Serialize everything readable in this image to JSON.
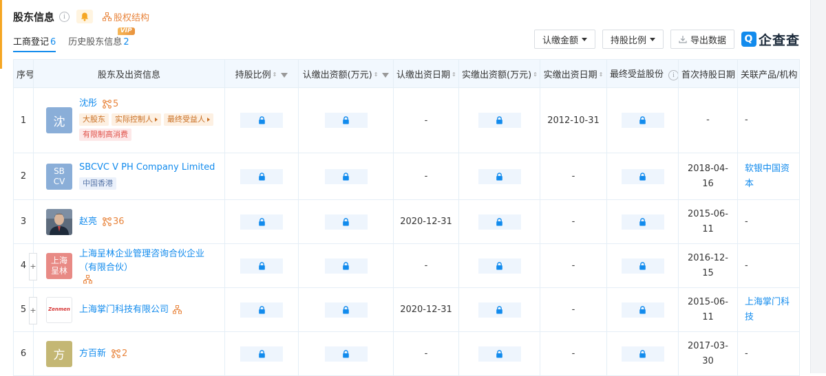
{
  "header": {
    "title": "股东信息",
    "info_icon": "i",
    "equity_link": "股权结构"
  },
  "tabs": [
    {
      "label": "工商登记",
      "count": "6",
      "active": true
    },
    {
      "label": "历史股东信息",
      "count": "2",
      "badge": "VIP"
    }
  ],
  "toolbar": {
    "subscribed_amount": "认缴金额",
    "share_ratio": "持股比例",
    "export": "导出数据",
    "logo_mark": "Q",
    "logo_text": "企查查"
  },
  "table": {
    "headers": [
      "序号",
      "股东及出资信息",
      "持股比例",
      "认缴出资额(万元)",
      "认缴出资日期",
      "实缴出资额(万元)",
      "实缴出资日期",
      "最终受益股份",
      "首次持股日期",
      "关联产品/机构"
    ],
    "rows": [
      {
        "index": "1",
        "avatar_text": "沈",
        "avatar_color": "#8aaed8",
        "name": "沈彤",
        "relation_count": "5",
        "tags": [
          {
            "text": "大股东",
            "style": "orange",
            "arrow": false
          },
          {
            "text": "实际控制人",
            "style": "orange",
            "arrow": true
          },
          {
            "text": "最终受益人",
            "style": "orange",
            "arrow": true
          },
          {
            "text": "有限制高消费",
            "style": "red",
            "arrow": false
          }
        ],
        "sub_date": "-",
        "paid_date": "2012-10-31",
        "first_date": "-",
        "related": "-"
      },
      {
        "index": "2",
        "avatar_text": "SB CV",
        "avatar_color": "#8aaed8",
        "name": "SBCVC V PH Company Limited",
        "tags": [
          {
            "text": "中国香港",
            "style": "blue",
            "arrow": false
          }
        ],
        "sub_date": "-",
        "paid_date": "-",
        "first_date": "2018-04-16",
        "related": "软银中国资本"
      },
      {
        "index": "3",
        "avatar_text": "",
        "avatar_color": "#4a5563",
        "photo": true,
        "name": "赵亮",
        "relation_count": "36",
        "tags": [],
        "sub_date": "2020-12-31",
        "paid_date": "-",
        "first_date": "2015-06-11",
        "related": "-"
      },
      {
        "index": "4",
        "avatar_text": "上海 呈林",
        "avatar_color": "#e88a85",
        "expand": "+",
        "name": "上海呈林企业管理咨询合伙企业（有限合伙）",
        "structure_icon": true,
        "tags": [],
        "sub_date": "-",
        "paid_date": "-",
        "first_date": "2016-12-15",
        "related": "-"
      },
      {
        "index": "5",
        "avatar_text": "Zenmen",
        "avatar_color": "#ffffff",
        "expand": "+",
        "name": "上海掌门科技有限公司",
        "structure_icon": true,
        "tags": [],
        "sub_date": "2020-12-31",
        "paid_date": "-",
        "first_date": "2015-06-11",
        "related": "上海掌门科技"
      },
      {
        "index": "6",
        "avatar_text": "方",
        "avatar_color": "#c4b774",
        "name": "方百新",
        "relation_count": "2",
        "tags": [],
        "sub_date": "-",
        "paid_date": "-",
        "first_date": "2017-03-30",
        "related": "-"
      }
    ]
  },
  "colors": {
    "accent": "#128bed",
    "orange": "#e8843c",
    "header_bg": "#f2f8fe"
  },
  "icons": [
    "info-icon",
    "bell-icon",
    "equity-structure-icon",
    "caret-down-icon",
    "export-icon",
    "lock-icon",
    "relation-icon",
    "sort-icon",
    "filter-icon",
    "structure-icon"
  ]
}
